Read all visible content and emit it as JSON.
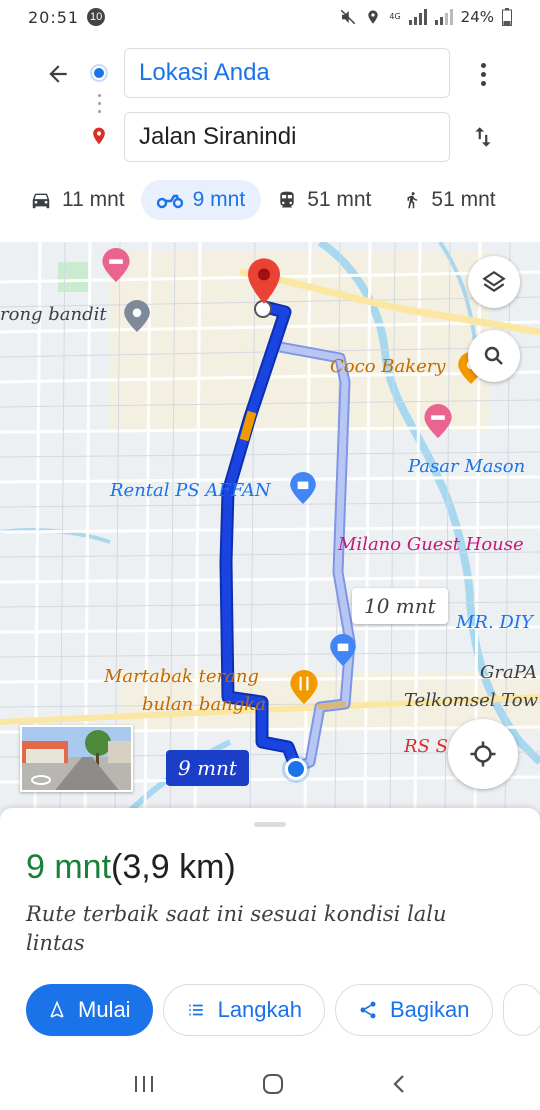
{
  "status_bar": {
    "time": "20:51",
    "notification_count": "10",
    "network": "4G",
    "battery": "24%"
  },
  "directions": {
    "origin": "Lokasi Anda",
    "destination": "Jalan Siranindi"
  },
  "modes": [
    {
      "name": "car",
      "label": "11 mnt",
      "active": false
    },
    {
      "name": "motorcycle",
      "label": "9 mnt",
      "active": true
    },
    {
      "name": "transit",
      "label": "51 mnt",
      "active": false
    },
    {
      "name": "walk",
      "label": "51 mnt",
      "active": false
    }
  ],
  "map": {
    "pois": {
      "rong_bandit": "rong bandit",
      "coco_bakery": "Coco Bakery",
      "pasar_mason": "Pasar Mason",
      "rental_ps": "Rental PS AFFAN",
      "milano": "Milano Guest House",
      "mr_diy": "MR. DIY",
      "grapari": "GraPA",
      "telkomsel": "Telkomsel Tow",
      "martabak_line1": "Martabak terang",
      "martabak_line2": "bulan bangka",
      "rs": "RS S"
    },
    "route_label_primary": "9 mnt",
    "route_label_alt": "10 mnt",
    "colors": {
      "primary_route": "#1a44e0",
      "alt_route": "#a8b8f0",
      "traffic_slow": "#f29900"
    }
  },
  "sheet": {
    "duration": "9 mnt",
    "distance": "(3,9 km)",
    "description": "Rute terbaik saat ini sesuai kondisi lalu lintas",
    "buttons": {
      "start": "Mulai",
      "steps": "Langkah",
      "share": "Bagikan"
    }
  },
  "colors": {
    "accent": "#1a73e8",
    "duration_green": "#188038"
  }
}
